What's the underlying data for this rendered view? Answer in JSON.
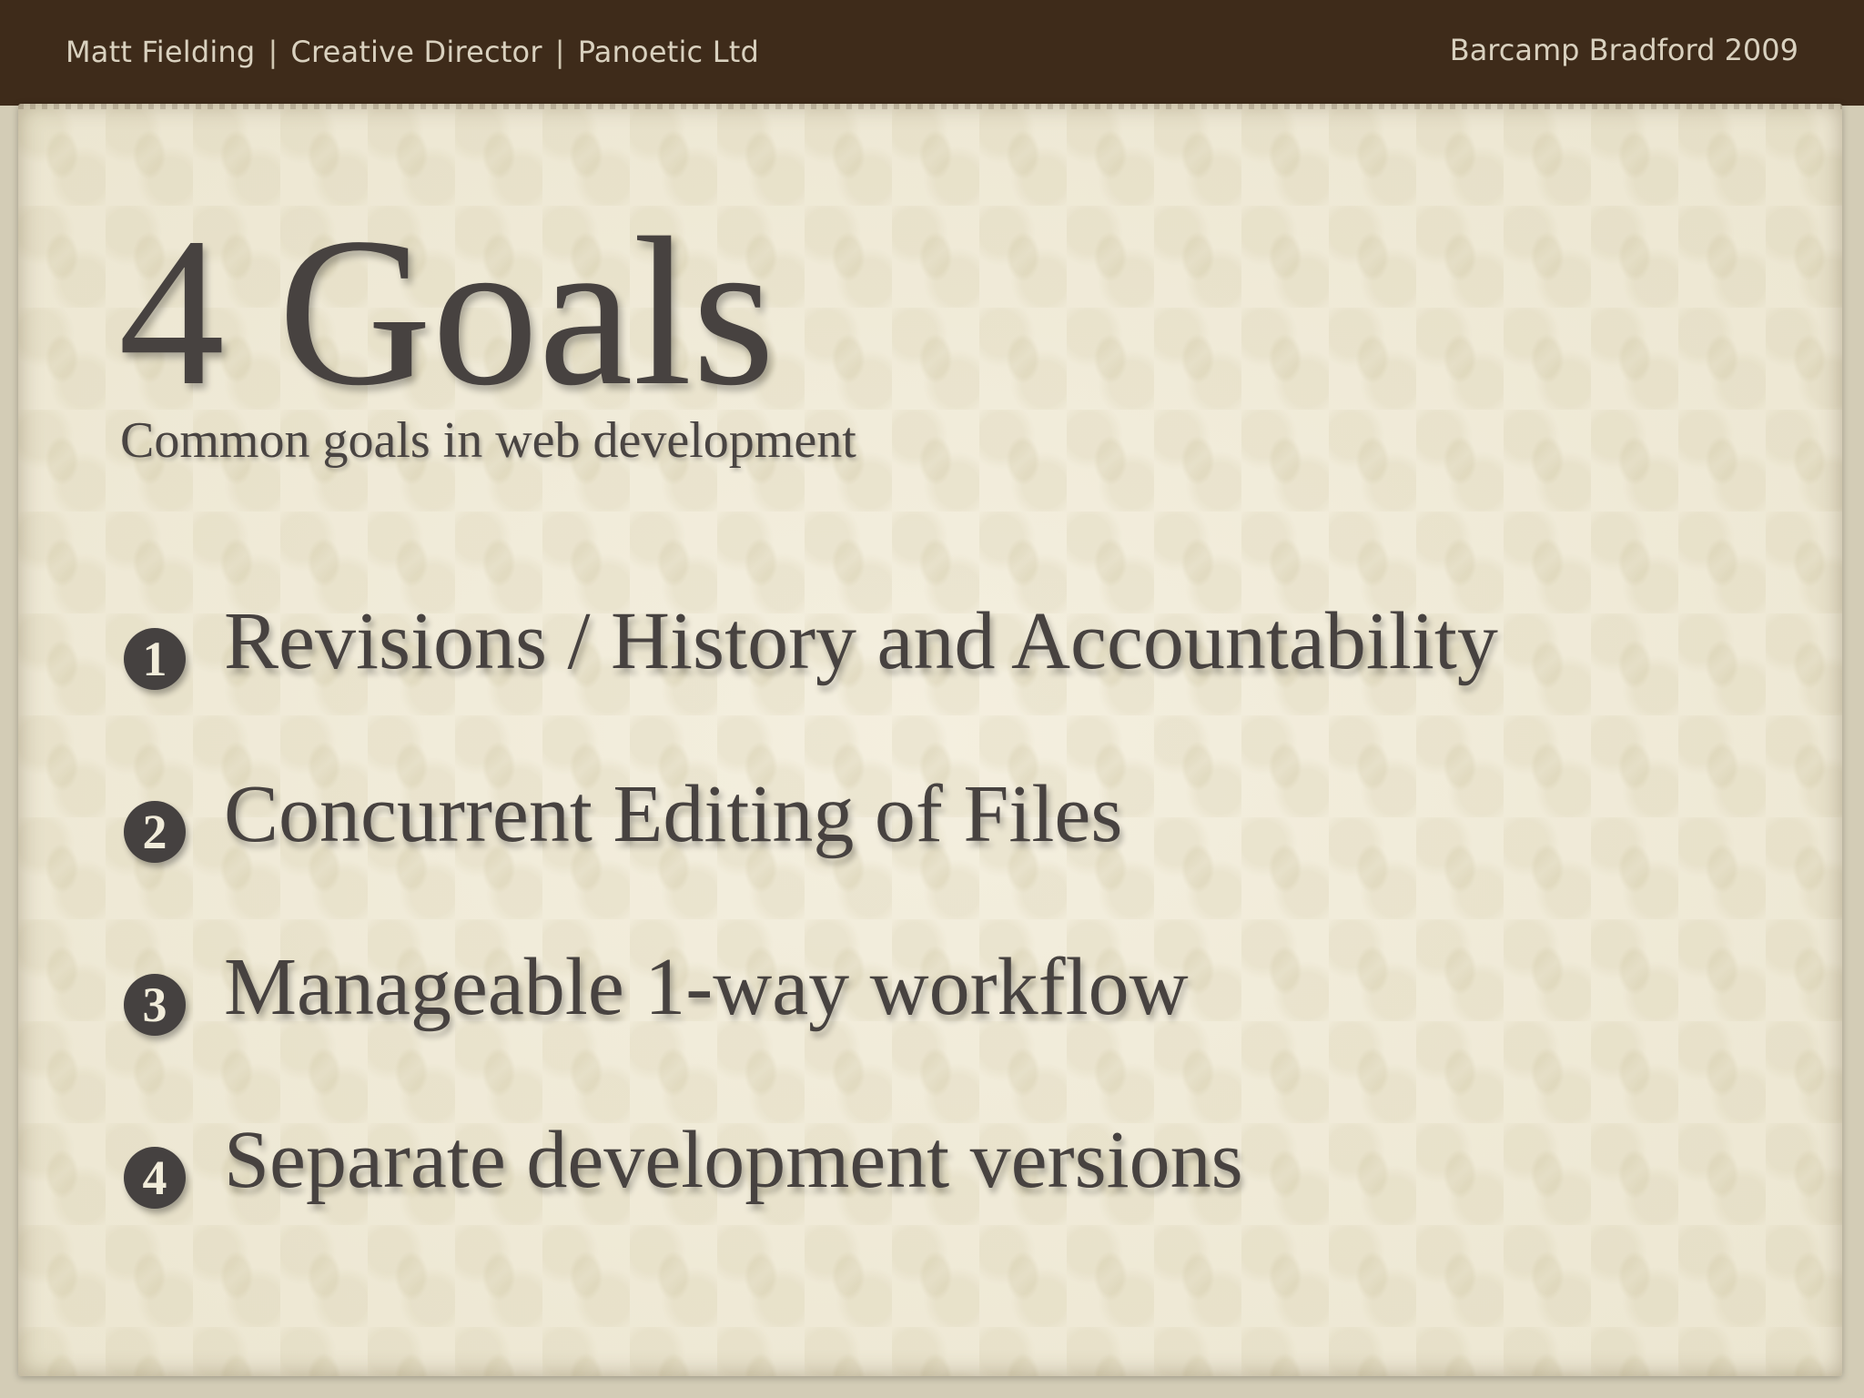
{
  "header": {
    "presenter": "Matt Fielding",
    "role": "Creative Director",
    "company": "Panoetic Ltd",
    "separator": "|",
    "event": "Barcamp Bradford 2009"
  },
  "slide": {
    "title": "4 Goals",
    "subtitle": "Common goals in web development",
    "goals": [
      {
        "number": "1",
        "text": "Revisions / History and Accountability"
      },
      {
        "number": "2",
        "text": "Concurrent Editing of Files"
      },
      {
        "number": "3",
        "text": "Manageable 1-way workflow"
      },
      {
        "number": "4",
        "text": "Separate development versions"
      }
    ]
  },
  "colors": {
    "header_bar": "#3e2b1a",
    "paper": "#f1ecda",
    "text": "#474240"
  }
}
